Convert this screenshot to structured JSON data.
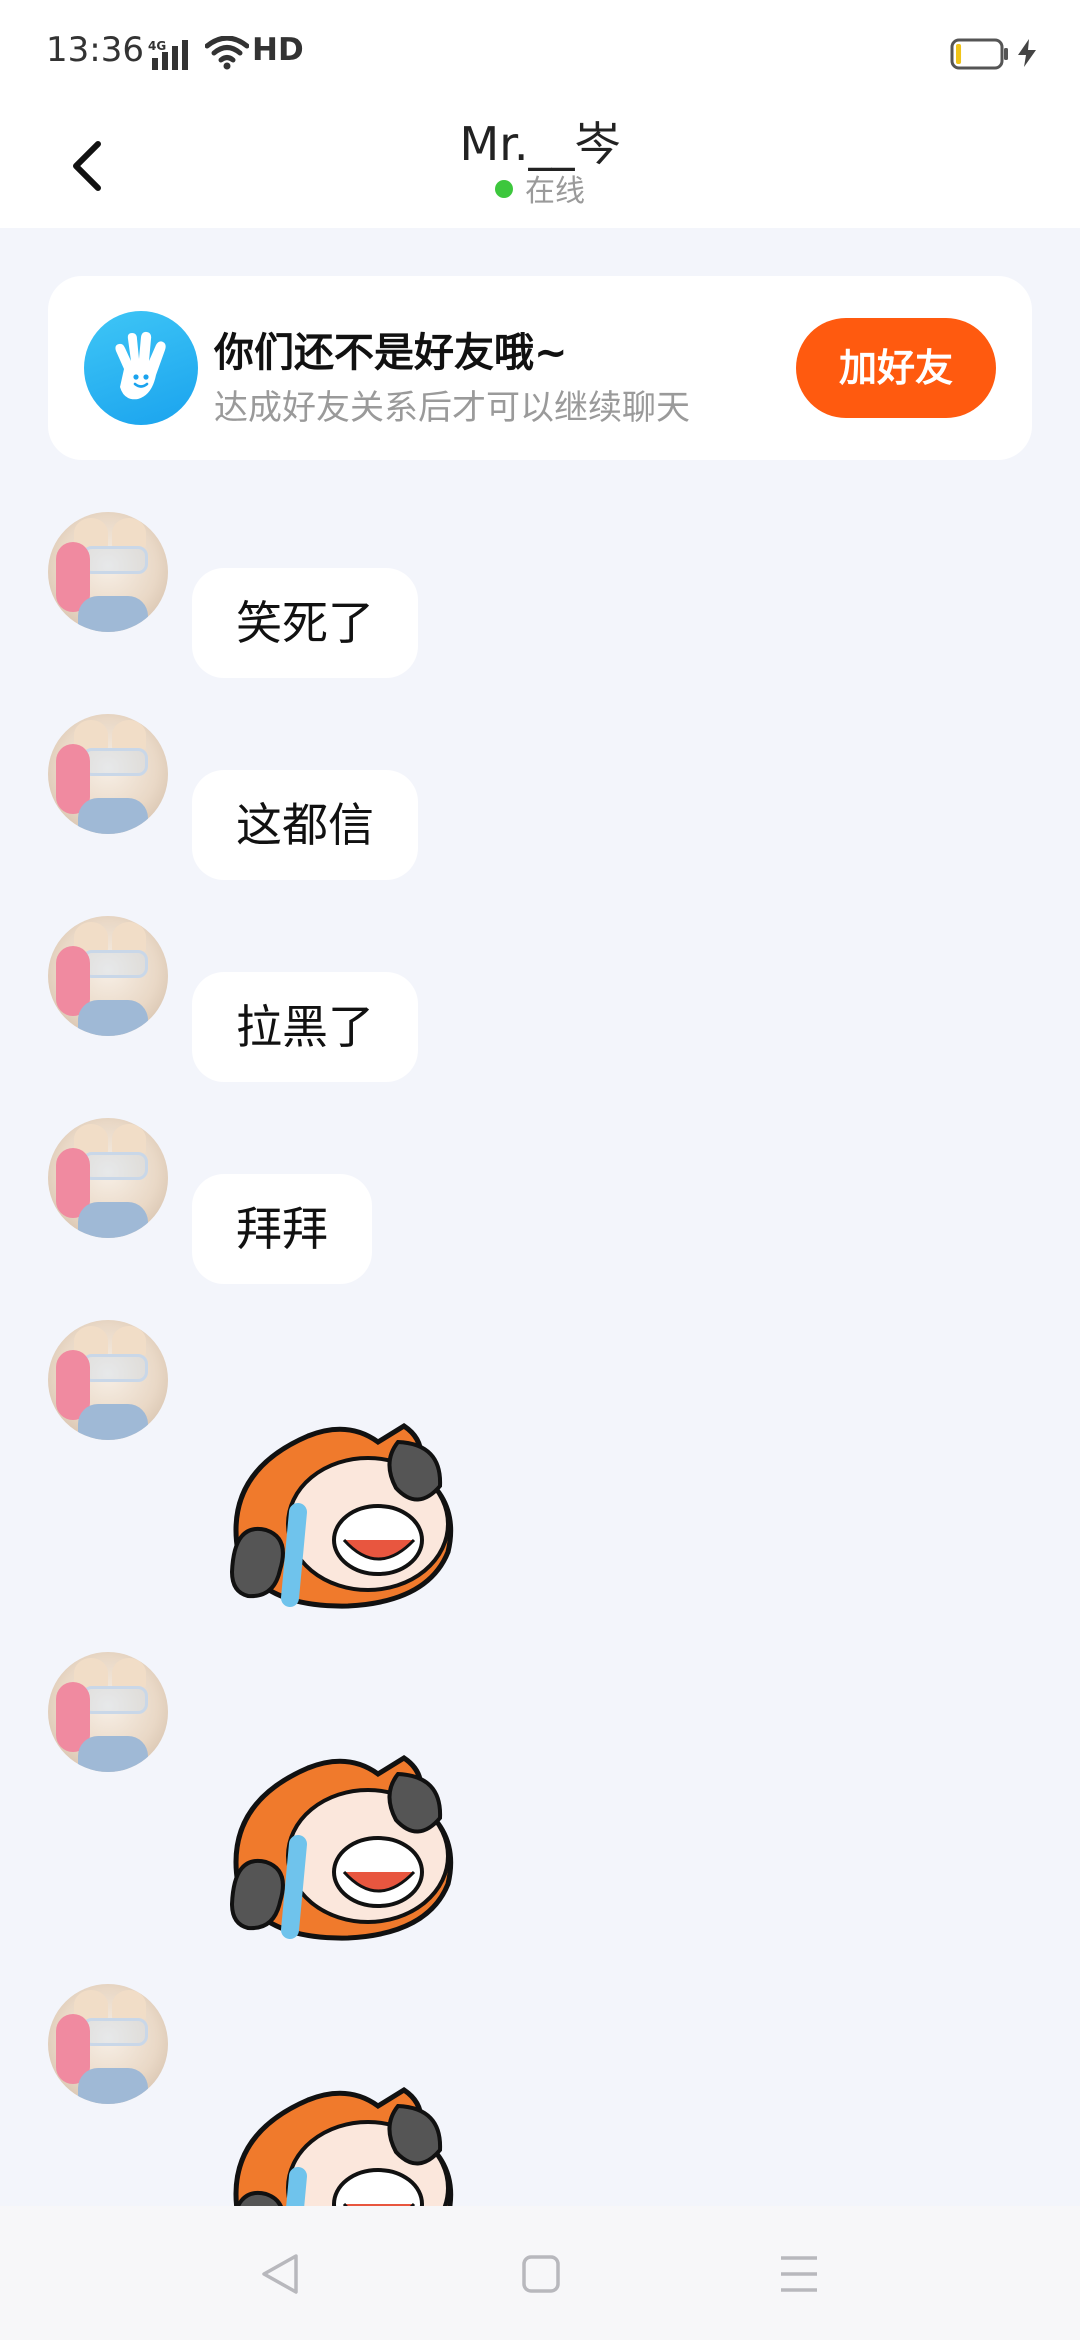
{
  "status_bar": {
    "time": "13:36",
    "network": "4G",
    "hd": "HD",
    "battery_level": 0.08
  },
  "header": {
    "title": "Mr.__岑",
    "status": "在线",
    "status_color": "#3dc73d"
  },
  "friend_banner": {
    "title": "你们还不是好友哦~",
    "subtitle": "达成好友关系后才可以继续聊天",
    "button_label": "加好友",
    "button_color": "#ff5a0f",
    "icon": "wave-hand-icon"
  },
  "messages": [
    {
      "type": "text",
      "text": "笑死了"
    },
    {
      "type": "text",
      "text": "这都信"
    },
    {
      "type": "text",
      "text": "拉黑了"
    },
    {
      "type": "text",
      "text": "拜拜"
    },
    {
      "type": "sticker",
      "sticker": "crying-laughing-sticker"
    },
    {
      "type": "sticker",
      "sticker": "crying-laughing-sticker"
    },
    {
      "type": "sticker",
      "sticker": "crying-laughing-sticker"
    }
  ],
  "nav_bar": {
    "back": "nav-back-icon",
    "home": "nav-home-icon",
    "menu": "nav-menu-icon"
  },
  "colors": {
    "page_background": "#f3f5fb",
    "bubble": "#ffffff"
  }
}
